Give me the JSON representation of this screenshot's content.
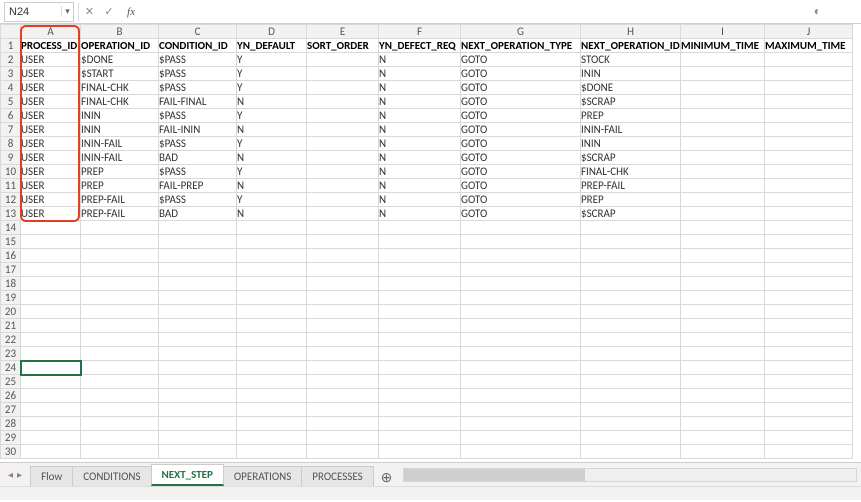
{
  "formula_bar": {
    "name_box_value": "N24",
    "cancel_icon": "✕",
    "confirm_icon": "✓",
    "fx_label": "fx",
    "formula_value": ""
  },
  "columns": [
    {
      "id": "A",
      "class": "colA"
    },
    {
      "id": "B",
      "class": "colB"
    },
    {
      "id": "C",
      "class": "colC"
    },
    {
      "id": "D",
      "class": "colD"
    },
    {
      "id": "E",
      "class": "colE"
    },
    {
      "id": "F",
      "class": "colF"
    },
    {
      "id": "G",
      "class": "colG"
    },
    {
      "id": "H",
      "class": "colH"
    },
    {
      "id": "I",
      "class": "colI"
    },
    {
      "id": "J",
      "class": "colJ"
    }
  ],
  "row_count": 30,
  "header_row": [
    "PROCESS_ID",
    "OPERATION_ID",
    "CONDITION_ID",
    "YN_DEFAULT",
    "SORT_ORDER",
    "YN_DEFECT_REQ",
    "NEXT_OPERATION_TYPE",
    "NEXT_OPERATION_ID",
    "MINIMUM_TIME",
    "MAXIMUM_TIME"
  ],
  "data_rows": [
    [
      "USER",
      "$DONE",
      "$PASS",
      "Y",
      "",
      "N",
      "GOTO",
      "STOCK",
      "",
      ""
    ],
    [
      "USER",
      "$START",
      "$PASS",
      "Y",
      "",
      "N",
      "GOTO",
      "ININ",
      "",
      ""
    ],
    [
      "USER",
      "FINAL-CHK",
      "$PASS",
      "Y",
      "",
      "N",
      "GOTO",
      "$DONE",
      "",
      ""
    ],
    [
      "USER",
      "FINAL-CHK",
      "FAIL-FINAL",
      "N",
      "",
      "N",
      "GOTO",
      "$SCRAP",
      "",
      ""
    ],
    [
      "USER",
      "ININ",
      "$PASS",
      "Y",
      "",
      "N",
      "GOTO",
      "PREP",
      "",
      ""
    ],
    [
      "USER",
      "ININ",
      "FAIL-ININ",
      "N",
      "",
      "N",
      "GOTO",
      "ININ-FAIL",
      "",
      ""
    ],
    [
      "USER",
      "ININ-FAIL",
      "$PASS",
      "Y",
      "",
      "N",
      "GOTO",
      "ININ",
      "",
      ""
    ],
    [
      "USER",
      "ININ-FAIL",
      "BAD",
      "N",
      "",
      "N",
      "GOTO",
      "$SCRAP",
      "",
      ""
    ],
    [
      "USER",
      "PREP",
      "$PASS",
      "Y",
      "",
      "N",
      "GOTO",
      "FINAL-CHK",
      "",
      ""
    ],
    [
      "USER",
      "PREP",
      "FAIL-PREP",
      "N",
      "",
      "N",
      "GOTO",
      "PREP-FAIL",
      "",
      ""
    ],
    [
      "USER",
      "PREP-FAIL",
      "$PASS",
      "Y",
      "",
      "N",
      "GOTO",
      "PREP",
      "",
      ""
    ],
    [
      "USER",
      "PREP-FAIL",
      "BAD",
      "N",
      "",
      "N",
      "GOTO",
      "$SCRAP",
      "",
      ""
    ]
  ],
  "selected_cell": {
    "row": 24,
    "col": "A"
  },
  "highlight": {
    "description": "Column A header and cells rows 1-13 outlined in red"
  },
  "tabs": [
    {
      "label": "Flow",
      "active": false
    },
    {
      "label": "CONDITIONS",
      "active": false
    },
    {
      "label": "NEXT_STEP",
      "active": true
    },
    {
      "label": "OPERATIONS",
      "active": false
    },
    {
      "label": "PROCESSES",
      "active": false
    }
  ],
  "add_tab_label": "⊕"
}
